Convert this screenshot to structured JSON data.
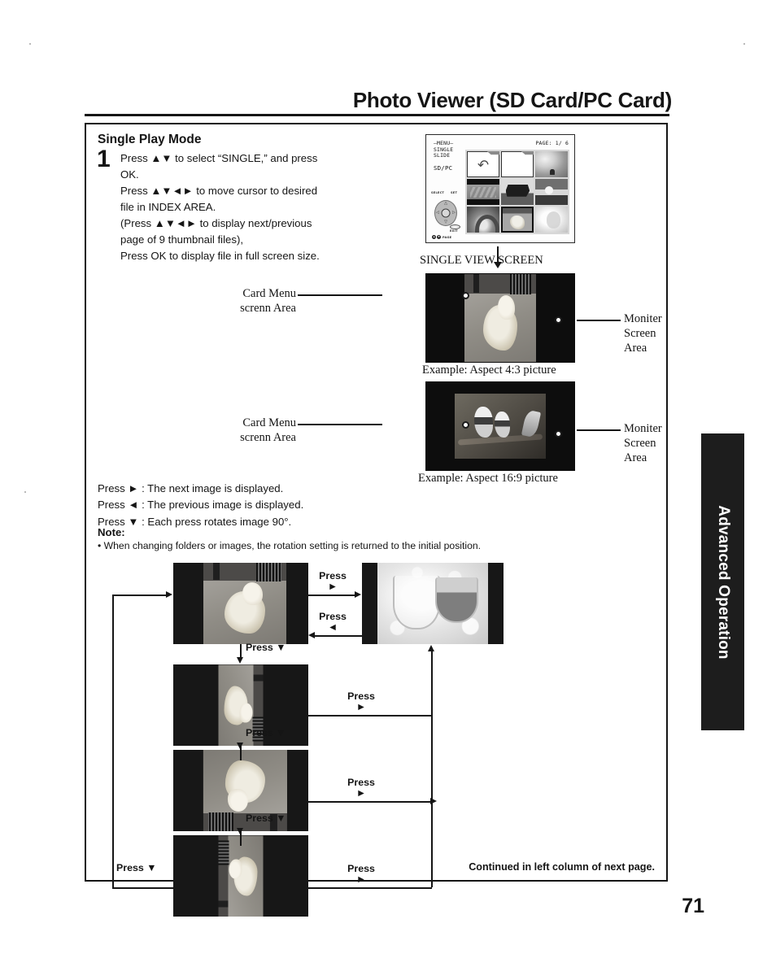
{
  "page": {
    "title": "Photo Viewer (SD Card/PC Card)",
    "number": "71",
    "side_tab": "Advanced Operation",
    "continued_note": "Continued in left column of next page."
  },
  "section": {
    "heading": "Single Play Mode",
    "step_number": "1",
    "step_lines": [
      "Press ▲▼ to select “SINGLE,” and press",
      "OK.",
      "Press ▲▼◄► to move cursor to desired",
      "file in INDEX AREA.",
      "(Press ▲▼◄► to display next/previous",
      "page of 9 thumbnail files),",
      "Press OK to display file in full screen size."
    ]
  },
  "card_menu_screen": {
    "menu_label": "–MENU–",
    "mode_single": "SINGLE",
    "mode_slide": "SLIDE",
    "source_label": "SD/PC",
    "page_label": "PAGE:",
    "page_value": "1/ 6",
    "remote": {
      "select_label": "SELECT",
      "set_label": "SET",
      "exit_label": "EXIT",
      "page_label": "PAGE",
      "pad_up": "△",
      "pad_down": "▽",
      "pad_left": "◁",
      "pad_right": "▷"
    },
    "thumbnails": [
      {
        "name": "folder-up",
        "kind": "folder",
        "selected": false
      },
      {
        "name": "folder",
        "kind": "folder-plain",
        "selected": false
      },
      {
        "name": "clouds-photo",
        "kind": "ph-clouds",
        "selected": false
      },
      {
        "name": "road-photo",
        "kind": "ph-road",
        "selected": false
      },
      {
        "name": "ship-photo",
        "kind": "ph-ship",
        "selected": false
      },
      {
        "name": "sunset-photo",
        "kind": "ph-sunset",
        "selected": false
      },
      {
        "name": "arch-photo",
        "kind": "ph-arch",
        "selected": false
      },
      {
        "name": "dog-photo",
        "kind": "ph-dog",
        "selected": true
      },
      {
        "name": "white-photo",
        "kind": "ph-white",
        "selected": false
      }
    ]
  },
  "single_view": {
    "screen_title": "SINGLE VIEW SCREEN",
    "examples": [
      {
        "caption": "Example: Aspect 4:3 picture",
        "left_callout": [
          "Card Menu",
          "screnn Area"
        ],
        "right_callout": [
          "Moniter",
          "Screen Area"
        ]
      },
      {
        "caption": "Example: Aspect 16:9 picture",
        "left_callout": [
          "Card Menu",
          "screnn Area"
        ],
        "right_callout": [
          "Moniter",
          "Screen Area"
        ]
      }
    ]
  },
  "press_instructions": [
    "Press ► : The next image is displayed.",
    "Press ◄ : The previous image is displayed.",
    "Press ▼ : Each press rotates image 90°."
  ],
  "note": {
    "heading": "Note:",
    "body": "•  When changing folders or images, the rotation setting is returned to the initial position."
  },
  "rotation_flow": {
    "labels": {
      "press_right_1": "Press",
      "press_right_1_arrow": "►",
      "press_left_1": "Press",
      "press_left_1_arrow": "◄",
      "press_down_1": "Press ▼",
      "press_right_2": "Press",
      "press_right_2_arrow": "►",
      "press_down_2": "Press ▼",
      "press_right_3": "Press",
      "press_right_3_arrow": "►",
      "press_down_3": "Press ▼",
      "press_down_4": "Press ▼",
      "press_right_4": "Press",
      "press_right_4_arrow": "►"
    }
  },
  "colors": {
    "ink": "#151515",
    "tab_bg": "#1d1d1d",
    "screen_black": "#171717",
    "menu_grid_bg": "#d7d7d7"
  }
}
